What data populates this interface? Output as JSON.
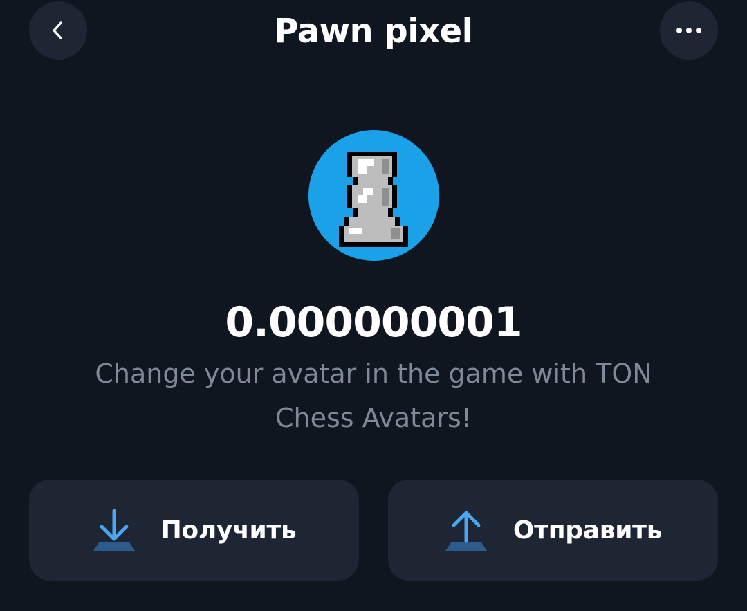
{
  "header": {
    "title": "Pawn pixel",
    "back_icon": "chevron-left-icon",
    "more_icon": "more-dots-icon"
  },
  "token": {
    "avatar_icon": "pixel-pawn-icon",
    "avatar_background": "#1aa1e8",
    "balance": "0.000000001",
    "description": "Change your avatar in the game with TON Chess Avatars!"
  },
  "actions": {
    "receive": {
      "label": "Получить",
      "icon": "arrow-down-icon"
    },
    "send": {
      "label": "Отправить",
      "icon": "arrow-up-icon"
    }
  },
  "colors": {
    "background": "#10161f",
    "surface": "#1e2633",
    "accent": "#4aa6f0",
    "text_secondary": "#7f8a98"
  }
}
